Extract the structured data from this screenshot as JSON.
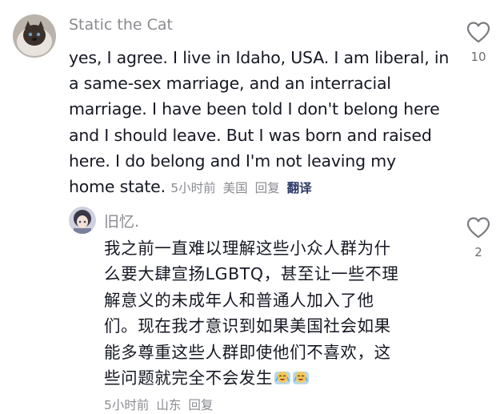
{
  "comments": [
    {
      "author": "Static the Cat",
      "text": "yes, I agree. I live in Idaho, USA. I am liberal, in a same-sex marriage, and an interracial marriage. I have been told I don't belong here and I should leave. But I was born and raised here. I do belong and I'm not leaving my home state.",
      "lines": [
        "yes, I agree. I live in Idaho, USA. I am liberal, in",
        "a same-sex marriage, and an interracial",
        "marriage. I have been told I don't belong here",
        "and I should leave. But I was born and raised",
        "here. I do belong and I'm not leaving my",
        "home state."
      ],
      "time": "5小时前",
      "location": "美国",
      "reply_label": "回复",
      "translate_label": "翻译",
      "like_count": "10",
      "like_icon": "heart-outline-icon",
      "avatar_icon": "cat-avatar"
    },
    {
      "author": "旧忆.",
      "text": "我之前一直难以理解这些小众人群为什么要大肆宣扬LGBTQ，甚至让一些不理解意义的未成年人和普通人加入了他们。现在我才意识到如果美国社会如果能多尊重这些人群即使他们不喜欢，这些问题就完全不会发生",
      "lines": [
        "我之前一直难以理解这些小众人群为什",
        "么要大肆宣扬LGBTQ，甚至让一些不理",
        "解意义的未成年人和普通人加入了他",
        "们。现在我才意识到如果美国社会如果",
        "能多尊重这些人群即使他们不喜欢，这",
        "些问题就完全不会发生"
      ],
      "emojis": [
        "laughing-crying-emoji",
        "laughing-crying-emoji"
      ],
      "time": "5小时前",
      "location": "山东",
      "reply_label": "回复",
      "like_count": "2",
      "like_icon": "heart-outline-icon",
      "avatar_icon": "anime-avatar"
    }
  ],
  "colors": {
    "text": "#161823",
    "muted": "#8a8b91",
    "translate": "#2b3a67"
  }
}
